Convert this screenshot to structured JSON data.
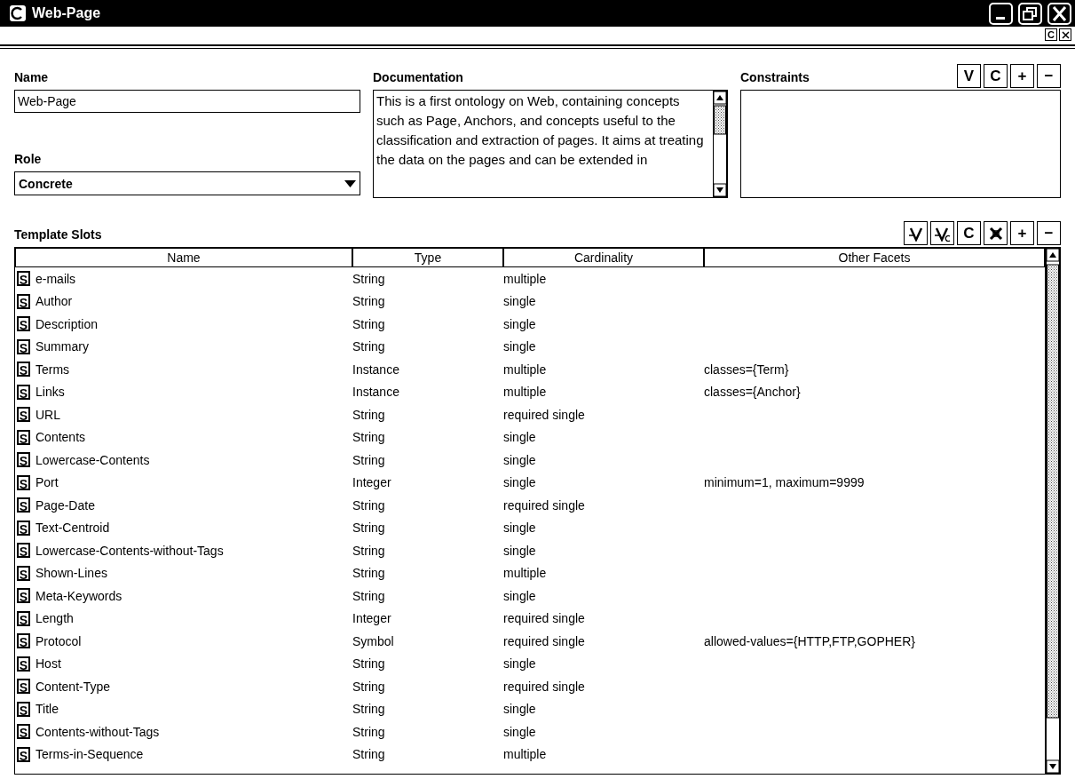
{
  "window": {
    "title": "Web-Page"
  },
  "subbar": {
    "buttons": [
      "C"
    ]
  },
  "name": {
    "label": "Name",
    "value": "Web-Page"
  },
  "role": {
    "label": "Role",
    "value": "Concrete"
  },
  "documentation": {
    "label": "Documentation",
    "text": "This is a first ontology on Web, containing concepts such as Page, Anchors, and concepts useful to the classification and extraction of pages. It aims at treating the data on the pages and can be extended in"
  },
  "constraints": {
    "label": "Constraints",
    "buttons": [
      "V",
      "C",
      "+",
      "−"
    ]
  },
  "template_slots": {
    "label": "Template Slots",
    "buttons": [
      {
        "kind": "view"
      },
      {
        "kind": "view-top"
      },
      {
        "kind": "text",
        "label": "C"
      },
      {
        "kind": "remove"
      },
      {
        "kind": "text",
        "label": "+"
      },
      {
        "kind": "text",
        "label": "−"
      }
    ],
    "columns": [
      "Name",
      "Type",
      "Cardinality",
      "Other Facets"
    ],
    "rows": [
      {
        "badge": "S",
        "name": "e-mails",
        "type": "String",
        "cardinality": "multiple"
      },
      {
        "badge": "S",
        "name": "Author",
        "type": "String",
        "cardinality": "single"
      },
      {
        "badge": "S",
        "name": "Description",
        "type": "String",
        "cardinality": "single"
      },
      {
        "badge": "S",
        "name": "Summary",
        "type": "String",
        "cardinality": "single"
      },
      {
        "badge": "S",
        "name": "Terms",
        "type": "Instance",
        "cardinality": "multiple",
        "facets": "classes={Term}"
      },
      {
        "badge": "S",
        "name": "Links",
        "type": "Instance",
        "cardinality": "multiple",
        "facets": "classes={Anchor}"
      },
      {
        "badge": "S",
        "name": "URL",
        "type": "String",
        "cardinality": "required single"
      },
      {
        "badge": "S",
        "name": "Contents",
        "type": "String",
        "cardinality": "single"
      },
      {
        "badge": "S",
        "name": "Lowercase-Contents",
        "type": "String",
        "cardinality": "single"
      },
      {
        "badge": "S",
        "name": "Port",
        "type": "Integer",
        "cardinality": "single",
        "facets": "minimum=1, maximum=9999"
      },
      {
        "badge": "S",
        "name": "Page-Date",
        "type": "String",
        "cardinality": "required single"
      },
      {
        "badge": "S",
        "name": "Text-Centroid",
        "type": "String",
        "cardinality": "single"
      },
      {
        "badge": "S",
        "name": "Lowercase-Contents-without-Tags",
        "type": "String",
        "cardinality": "single"
      },
      {
        "badge": "S",
        "name": "Shown-Lines",
        "type": "String",
        "cardinality": "multiple"
      },
      {
        "badge": "S",
        "name": "Meta-Keywords",
        "type": "String",
        "cardinality": "single"
      },
      {
        "badge": "S",
        "name": "Length",
        "type": "Integer",
        "cardinality": "required single"
      },
      {
        "badge": "S",
        "name": "Protocol",
        "type": "Symbol",
        "cardinality": "required single",
        "facets": "allowed-values={HTTP,FTP,GOPHER}"
      },
      {
        "badge": "S",
        "name": "Host",
        "type": "String",
        "cardinality": "single"
      },
      {
        "badge": "S",
        "name": "Content-Type",
        "type": "String",
        "cardinality": "required single"
      },
      {
        "badge": "S",
        "name": "Title",
        "type": "String",
        "cardinality": "single"
      },
      {
        "badge": "S",
        "name": "Contents-without-Tags",
        "type": "String",
        "cardinality": "single"
      },
      {
        "badge": "S",
        "name": "Terms-in-Sequence",
        "type": "String",
        "cardinality": "multiple"
      }
    ]
  }
}
